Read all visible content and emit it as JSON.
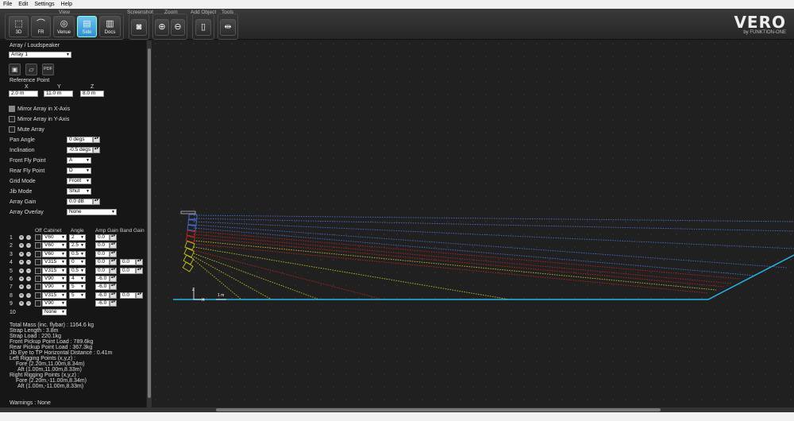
{
  "menu": [
    "File",
    "Edit",
    "Settings",
    "Help"
  ],
  "toolbar": {
    "view_label": "View",
    "view_buttons": [
      "3D",
      "FR",
      "Venue",
      "Side",
      "Docs"
    ],
    "screenshot_label": "Screenshot",
    "zoom_label": "Zoom",
    "add_object_label": "Add Object",
    "tools_label": "Tools"
  },
  "logo": {
    "main": "VERO",
    "sub": "by FUNKTION-ONE"
  },
  "panel": {
    "section_title": "Array / Loudspeaker",
    "array_select": "Array 1",
    "pdf_label": "PDF",
    "ref_title": "Reference Point",
    "x_label": "X",
    "y_label": "Y",
    "z_label": "Z",
    "x_val": "2.0 m",
    "y_val": "11.0 m",
    "z_val": "8.0 m",
    "mirror_x": "Mirror Array in X-Axis",
    "mirror_y": "Mirror Array in Y-Axis",
    "mute": "Mute Array",
    "pan_label": "Pan Angle",
    "pan_val": "0 degs",
    "incl_label": "Inclination",
    "incl_val": "-0.5 degs",
    "front_fly_label": "Front Fly Point",
    "front_fly_val": "A",
    "rear_fly_label": "Rear Fly Point",
    "rear_fly_val": "D",
    "grid_label": "Grid Mode",
    "grid_val": "Front",
    "jib_label": "Jib Mode",
    "jib_val": "Shut",
    "gain_label": "Array Gain",
    "gain_val": "0.0 dB",
    "overlay_label": "Array Overlay",
    "overlay_val": "None"
  },
  "table": {
    "headers": [
      "Off",
      "Cabinet",
      "Angle",
      "Amp Gain",
      "Band Gain"
    ],
    "rows": [
      {
        "n": "1",
        "cab": "V60",
        "angle": "2",
        "amp": "0.0",
        "band": ""
      },
      {
        "n": "2",
        "cab": "V60",
        "angle": "2.5",
        "amp": "0.0",
        "band": ""
      },
      {
        "n": "3",
        "cab": "V60",
        "angle": "0.5",
        "amp": "0.0",
        "band": ""
      },
      {
        "n": "4",
        "cab": "V315",
        "angle": "0",
        "amp": "0.0",
        "band": "0.0"
      },
      {
        "n": "5",
        "cab": "V315",
        "angle": "0.5",
        "amp": "0.0",
        "band": "0.0"
      },
      {
        "n": "6",
        "cab": "V90",
        "angle": "4",
        "amp": "-6.0",
        "band": ""
      },
      {
        "n": "7",
        "cab": "V90",
        "angle": "5",
        "amp": "-6.0",
        "band": ""
      },
      {
        "n": "8",
        "cab": "V315",
        "angle": "5",
        "amp": "-6.0",
        "band": "0.0"
      },
      {
        "n": "9",
        "cab": "V90",
        "angle": "",
        "amp": "-6.0",
        "band": ""
      },
      {
        "n": "10",
        "cab": "None",
        "angle": "",
        "amp": "",
        "band": ""
      }
    ]
  },
  "stats": {
    "total_mass": "Total Mass (inc. flybar) : 1164.6 kg",
    "strap_length": "Strap Length : 3.8m",
    "strap_load": "Strap Load : 220.1kg",
    "front_load": "Front Pickup Point Load : 789.6kg",
    "rear_load": "Rear Pickup Point Load : 367.3kg",
    "jib_dist": "Jib Eye to TP Horizontal Distance : 0.41m",
    "left_title": "Left Rigging Points (x,y,z) :",
    "left_fore": "Fore (2.20m,11.00m,8.34m)",
    "left_aft": "Aft (1.00m,11.00m,8.33m)",
    "right_title": "Right Rigging Points (x,y,z) :",
    "right_fore": "Fore (2.20m,-11.00m,8.34m)",
    "right_aft": "Aft (1.00m,-11.00m,8.33m)",
    "warnings": "Warnings : None"
  },
  "canvas": {
    "axis_z": "Z",
    "axis_x": "X",
    "scale": "1 m",
    "colors": {
      "blue": "#4a6fd0",
      "red": "#c02020",
      "yellow": "#c8c020",
      "floor": "#29b6e6"
    }
  }
}
